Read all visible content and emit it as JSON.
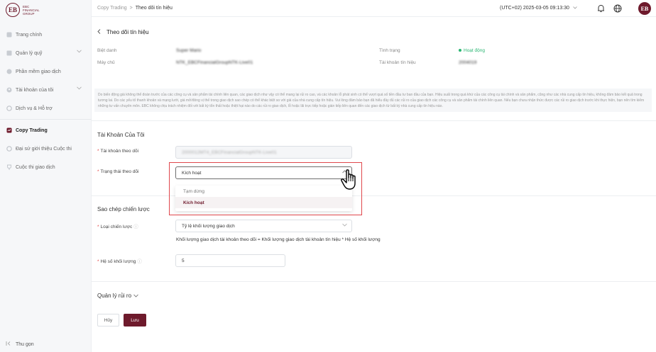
{
  "brand": {
    "logo_letter": "EB",
    "logo_text": [
      "EBC",
      "FINANCIAL",
      "GROUP"
    ],
    "color": "#6e1a2c"
  },
  "sidebar": {
    "items": [
      {
        "label": "Trang chính",
        "icon": "home-icon"
      },
      {
        "label": "Quản lý quỹ",
        "icon": "fund-icon",
        "expandable": true
      },
      {
        "label": "Phần mềm giao dịch",
        "icon": "software-icon"
      },
      {
        "label": "Tài khoản của tôi",
        "icon": "user-icon",
        "expandable": true
      },
      {
        "label": "Dịch vụ & Hỗ trợ",
        "icon": "support-icon"
      },
      {
        "label": "Copy Trading",
        "icon": "copy-trading-icon",
        "active": true
      },
      {
        "label": "Đại sứ giới thiệu Cuộc thi",
        "icon": "ambassador-icon"
      },
      {
        "label": "Cuộc thi giao dịch",
        "icon": "trophy-icon"
      }
    ],
    "collapse_label": "Thu gọn"
  },
  "topbar": {
    "breadcrumb_root": "Copy Trading",
    "breadcrumb_sep": ">",
    "breadcrumb_current": "Theo dõi tín hiệu",
    "timezone": "(UTC+02)  2025-03-05 09:13:30"
  },
  "page": {
    "title": "Theo dõi tín hiệu",
    "nickname_label": "Biệt danh",
    "nickname_value": "Super Mario",
    "owner_label": "Máy chủ",
    "owner_value": "NTK_EBCFinancialGroupNTK-Live01",
    "status_label": "Tình trạng",
    "status_value": "Hoạt động",
    "signal_account_label": "Tài khoản tín hiệu",
    "signal_account_value": "2004019",
    "disclaimer": "Do biến động giá không thể đoán trước của các công cụ và sản phẩm tài chính liên quan, các giao dịch như vậy có thể mang lại rủi ro cao, và các khoản lỗ phát sinh có thể vượt quá số tiền đầu tư ban đầu của bạn. Hiệu suất trong quá khứ của các công cụ tài chính và sản phẩm, cũng như các nhà cung cấp tín hiệu, không đảm bảo kết quả trong tương lai. Do các yếu tố thanh khoản và mạng lưới, giá mở/đóng vị thế trong giao dịch sao chép có thể khác biệt so với giá của nhà cung cấp tín hiệu. Vui lòng đảm bảo bạn đã hiểu đầy đủ các rủi ro của giao dịch các công cụ và sản phẩm tài chính liên quan. Nếu bạn chưa nhận thức được các rủi ro giao dịch trước khi thực hiện, bạn nên tìm kiếm những tư vấn chuyên môn. EBC không chịu trách nhiệm đối với bất kỳ tổn thất hoặc thiệt hại nào do các rủi ro giao dịch, lỗ hoặc lãi trực tiếp hoặc gián tiếp liên quan đến các giao dịch từ bất kỳ nhà cung cấp tín hiệu nào."
  },
  "my_account": {
    "section_title": "Tài Khoản Của Tôi",
    "follow_account_label": "Tài khoản theo dõi",
    "follow_account_value": "2000012MT4_EBCFinancialGroupNTK-Live01",
    "follow_status_label": "Trạng thái theo dõi",
    "follow_status_value": "Kích hoạt",
    "options": [
      "Tạm dừng",
      "Kích hoạt"
    ],
    "selected_option": "Kích hoạt"
  },
  "copy_strategy": {
    "section_title": "Sao chép chiến lược",
    "strategy_type_label": "Loại chiến lược",
    "strategy_type_value": "Tỷ lệ khối lượng giao dịch",
    "formula": "Khối lượng giao dịch tài khoản theo dõi = Khối lượng giao dịch tài khoản tín hiệu * Hệ số khối lượng",
    "volume_factor_label": "Hệ số khối lượng",
    "volume_factor_value": "5"
  },
  "risk": {
    "label": "Quản lý rủi ro"
  },
  "buttons": {
    "cancel": "Hủy",
    "save": "Lưu"
  },
  "colors": {
    "accent": "#6e1a2c",
    "status_green": "#2bb673",
    "highlight": "#e0474c"
  }
}
